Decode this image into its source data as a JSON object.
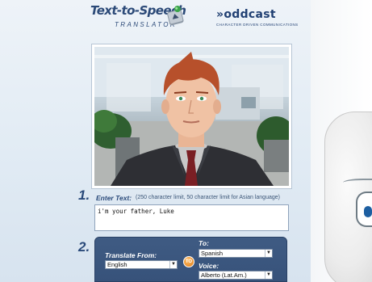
{
  "header": {
    "app_title": "Text-to-Speech",
    "app_subtitle": "TRANSLATOR",
    "brand_name": "»oddcast",
    "brand_tagline": "CHARACTER DRIVEN COMMUNICATIONS"
  },
  "step1": {
    "number": "1.",
    "label": "Enter Text:",
    "note": "(250 character limit, 50 character limit for Asian language)",
    "text_value": "i'm your father, Luke"
  },
  "step2": {
    "number": "2.",
    "translate_from_label": "Translate From:",
    "translate_from_value": "English",
    "to_badge": "TO",
    "to_label": "To:",
    "to_value": "Spanish",
    "voice_label": "Voice:",
    "voice_value": "Alberto (Lat.Am.)"
  },
  "colors": {
    "accent_blue": "#2a4a7a",
    "panel_blue": "#3f5b83",
    "badge_orange": "#e07a14"
  }
}
